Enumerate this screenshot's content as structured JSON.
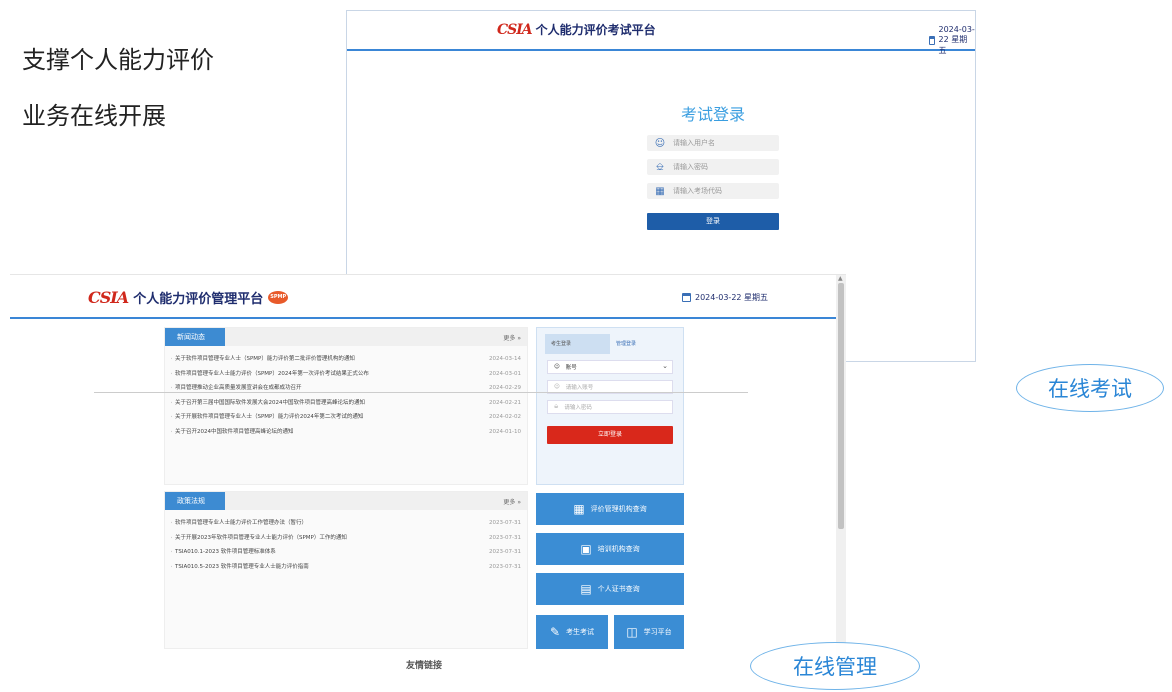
{
  "tagline": {
    "line1": "支撑个人能力评价",
    "line2": "业务在线开展"
  },
  "exam_window": {
    "logo_mark": "CSIA",
    "title": "个人能力评价考试平台",
    "date": "2024-03-22 星期五",
    "form": {
      "heading": "考试登录",
      "username_placeholder": "请输入用户名",
      "password_placeholder": "请输入密码",
      "site_code_placeholder": "请输入考场代码",
      "submit_label": "登录"
    }
  },
  "mgmt_window": {
    "logo_mark": "CSIA",
    "title": "个人能力评价管理平台",
    "badge": "SPMP",
    "date": "2024-03-22 星期五",
    "news": {
      "tab": "新闻动态",
      "more": "更多 »",
      "items": [
        {
          "title": "关于软件项目管理专业人士（SPMP）能力评价第二批评价管理机构的通知",
          "date": "2024-03-14"
        },
        {
          "title": "软件项目管理专业人士能力评价（SPMP）2024年第一次评价考试结果正式公布",
          "date": "2024-03-01"
        },
        {
          "title": "项目管理推动企业高质量发展宣讲会在成都成功召开",
          "date": "2024-02-29"
        },
        {
          "title": "关于召开第三届中国国际软件发展大会2024中国软件项目管理高峰论坛的通知",
          "date": "2024-02-21"
        },
        {
          "title": "关于开展软件项目管理专业人士（SPMP）能力评价2024年第二次考试的通知",
          "date": "2024-02-02"
        },
        {
          "title": "关于召开2024中国软件项目管理高峰论坛的通知",
          "date": "2024-01-10"
        }
      ]
    },
    "policy": {
      "tab": "政策法规",
      "more": "更多 »",
      "items": [
        {
          "title": "软件项目管理专业人士能力评价工作管理办法（暂行）",
          "date": "2023-07-31"
        },
        {
          "title": "关于开展2023年软件项目管理专业人士能力评价（SPMP）工作的通知",
          "date": "2023-07-31"
        },
        {
          "title": "TSIA010.1-2023 软件项目管理标准体系",
          "date": "2023-07-31"
        },
        {
          "title": "TSIA010.5-2023 软件项目管理专业人士能力评价指南",
          "date": "2023-07-31"
        }
      ]
    },
    "login": {
      "tab_candidate": "考生登录",
      "tab_admin": "管理登录",
      "select_value": "账号",
      "account_placeholder": "请输入账号",
      "password_placeholder": "请输入密码",
      "submit_label": "立即登录"
    },
    "buttons": {
      "org_query": "评价管理机构查询",
      "training_query": "培训机构查询",
      "cert_query": "个人证书查询",
      "exam": "考生考试",
      "study": "学习平台"
    },
    "footer": "友情链接"
  },
  "callouts": {
    "exam": "在线考试",
    "manage": "在线管理"
  },
  "colors": {
    "accent": "#3b8dd4",
    "brand_red": "#d0281c",
    "login_red": "#d9281b",
    "navy": "#1f2d6e"
  }
}
